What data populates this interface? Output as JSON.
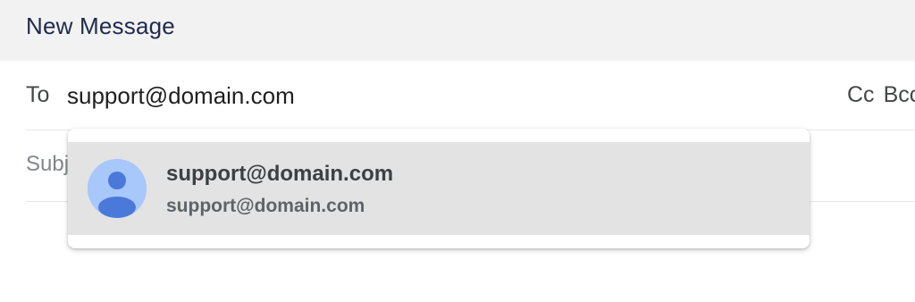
{
  "compose": {
    "title": "New Message",
    "to_label": "To",
    "to_value": "support@domain.com",
    "cc_label": "Cc",
    "bcc_label": "Bcc",
    "subject_placeholder": "Subject"
  },
  "suggestions": [
    {
      "name": "support@domain.com",
      "email": "support@domain.com",
      "avatar_icon": "person-icon"
    }
  ],
  "colors": {
    "header_bg": "#f2f2f2",
    "title": "#1f2a4e",
    "highlight": "#e3e3e3",
    "avatar_bg": "#a8c7fa",
    "avatar_fg": "#4a79d9"
  }
}
